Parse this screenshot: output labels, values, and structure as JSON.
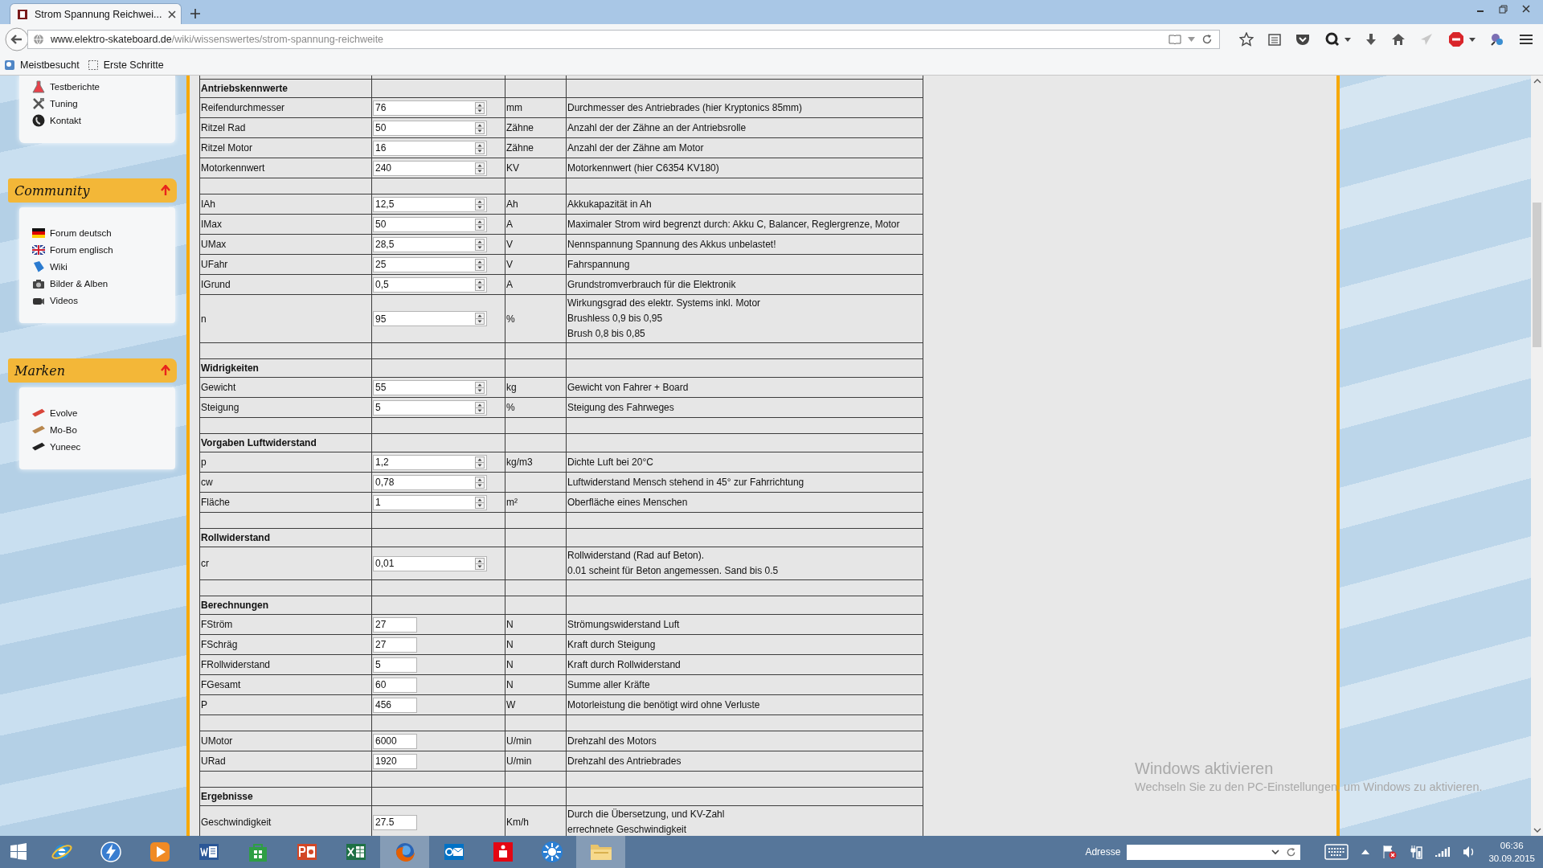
{
  "browser": {
    "tabs": [
      {
        "title": "Strom Spannung Reichwei...",
        "selected": true
      }
    ],
    "address": {
      "domain": "www.elektro-skateboard.de",
      "path": "/wiki/wissenswertes/strom-spannung-reichweite"
    },
    "bookmarks": [
      {
        "label": "Meistbesucht",
        "kind": "folder"
      },
      {
        "label": "Erste Schritte",
        "kind": "page"
      }
    ]
  },
  "sidebar": {
    "top_items": [
      {
        "label": "Testberichte",
        "kind": "flask"
      },
      {
        "label": "Tuning",
        "kind": "tools"
      },
      {
        "label": "Kontakt",
        "kind": "phone"
      }
    ],
    "sections": [
      {
        "title": "Community",
        "items": [
          {
            "label": "Forum deutsch",
            "kind": "germany"
          },
          {
            "label": "Forum englisch",
            "kind": "britain"
          },
          {
            "label": "Wiki",
            "kind": "book"
          },
          {
            "label": "Bilder & Alben",
            "kind": "camera"
          },
          {
            "label": "Videos",
            "kind": "camcorder"
          }
        ]
      },
      {
        "title": "Marken",
        "items": [
          {
            "label": "Evolve",
            "kind": "board",
            "color": "#d8453a"
          },
          {
            "label": "Mo-Bo",
            "kind": "board",
            "color": "#b8874e"
          },
          {
            "label": "Yuneec",
            "kind": "board",
            "color": "#222222"
          }
        ]
      }
    ]
  },
  "table": {
    "rows": [
      {
        "kind": "section",
        "label": "Antriebskennwerte"
      },
      {
        "kind": "spin",
        "parameter": "Reifendurchmesser",
        "value": "76",
        "unit": "mm",
        "remark": [
          "Durchmesser des Antriebrades (hier Kryptonics 85mm)"
        ]
      },
      {
        "kind": "spin",
        "parameter": "Ritzel Rad",
        "value": "50",
        "unit": "Zähne",
        "remark": [
          "Anzahl der der Zähne an der Antriebsrolle"
        ]
      },
      {
        "kind": "spin",
        "parameter": "Ritzel Motor",
        "value": "16",
        "unit": "Zähne",
        "remark": [
          "Anzahl der der Zähne am Motor"
        ]
      },
      {
        "kind": "spin",
        "parameter": "Motorkennwert",
        "value": "240",
        "unit": "KV",
        "remark": [
          "Motorkennwert (hier C6354 KV180)"
        ]
      },
      {
        "kind": "blank"
      },
      {
        "kind": "spin",
        "parameter": "IAh",
        "value": "12,5",
        "unit": "Ah",
        "remark": [
          "Akkukapazität in Ah"
        ]
      },
      {
        "kind": "spin",
        "parameter": "IMax",
        "value": "50",
        "unit": "A",
        "remark": [
          "Maximaler Strom wird begrenzt durch: Akku C, Balancer, Reglergrenze, Motor"
        ]
      },
      {
        "kind": "spin",
        "parameter": "UMax",
        "value": "28,5",
        "unit": "V",
        "remark": [
          "Nennspannung Spannung des Akkus unbelastet!"
        ]
      },
      {
        "kind": "spin",
        "parameter": "UFahr",
        "value": "25",
        "unit": "V",
        "remark": [
          "Fahrspannung"
        ]
      },
      {
        "kind": "spin",
        "parameter": "IGrund",
        "value": "0,5",
        "unit": "A",
        "remark": [
          "Grundstromverbrauch für die Elektronik"
        ]
      },
      {
        "kind": "spin",
        "parameter": "n",
        "value": "95",
        "unit": "%",
        "remark": [
          "Wirkungsgrad des elektr. Systems inkl. Motor",
          "Brushless 0,9 bis 0,95",
          "Brush 0,8 bis 0,85"
        ]
      },
      {
        "kind": "blank"
      },
      {
        "kind": "section",
        "label": "Widrigkeiten"
      },
      {
        "kind": "spin",
        "parameter": "Gewicht",
        "value": "55",
        "unit": "kg",
        "remark": [
          "Gewicht von Fahrer + Board"
        ]
      },
      {
        "kind": "spin",
        "parameter": "Steigung",
        "value": "5",
        "unit": "%",
        "remark": [
          "Steigung des Fahrweges"
        ]
      },
      {
        "kind": "blank"
      },
      {
        "kind": "section",
        "label": "Vorgaben Luftwiderstand"
      },
      {
        "kind": "spin",
        "parameter": "p",
        "value": "1,2",
        "unit": "kg/m3",
        "remark": [
          "Dichte Luft bei 20°C"
        ]
      },
      {
        "kind": "spin",
        "parameter": "cw",
        "value": "0,78",
        "remark": [
          "Luftwiderstand Mensch stehend in 45° zur Fahrrichtung"
        ]
      },
      {
        "kind": "spin",
        "parameter": "Fläche",
        "value": "1",
        "unit": "m²",
        "remark": [
          "Oberfläche eines Menschen"
        ]
      },
      {
        "kind": "blank"
      },
      {
        "kind": "section",
        "label": "Rollwiderstand"
      },
      {
        "kind": "spin",
        "parameter": "cr",
        "value": "0,01",
        "remark": [
          "Rollwiderstand (Rad auf Beton).",
          "0.01 scheint für Beton angemessen. Sand bis 0.5"
        ]
      },
      {
        "kind": "blank"
      },
      {
        "kind": "section",
        "label": "Berechnungen"
      },
      {
        "kind": "output",
        "parameter": "FStröm",
        "value": "27",
        "unit": "N",
        "remark": [
          "Strömungswiderstand Luft"
        ]
      },
      {
        "kind": "output",
        "parameter": "FSchräg",
        "value": "27",
        "unit": "N",
        "remark": [
          "Kraft durch Steigung"
        ]
      },
      {
        "kind": "output",
        "parameter": "FRollwiderstand",
        "value": "5",
        "unit": "N",
        "remark": [
          "Kraft durch Rollwiderstand"
        ]
      },
      {
        "kind": "output",
        "parameter": "FGesamt",
        "value": "60",
        "unit": "N",
        "remark": [
          "Summe aller Kräfte"
        ]
      },
      {
        "kind": "output",
        "parameter": "P",
        "value": "456",
        "unit": "W",
        "remark": [
          "Motorleistung die benötigt wird ohne Verluste"
        ]
      },
      {
        "kind": "blank"
      },
      {
        "kind": "output",
        "parameter": "UMotor",
        "value": "6000",
        "unit": "U/min",
        "remark": [
          "Drehzahl des Motors"
        ]
      },
      {
        "kind": "output",
        "parameter": "URad",
        "value": "1920",
        "unit": "U/min",
        "remark": [
          "Drehzahl des Antriebrades"
        ]
      },
      {
        "kind": "blank"
      },
      {
        "kind": "section",
        "label": "Ergebnisse"
      },
      {
        "kind": "output",
        "parameter": "Geschwindigkeit",
        "value": "27.5",
        "unit": "Km/h",
        "remark": [
          "Durch die Übersetzung, und KV-Zahl",
          "errechnete Geschwindigkeit"
        ]
      }
    ]
  },
  "notice": {
    "title": "Windows aktivieren",
    "text": "Wechseln Sie zu den PC-Einstellungen, um Windows zu aktivieren."
  },
  "taskbar": {
    "apps": [
      {
        "kind": "start",
        "running": false
      },
      {
        "kind": "orbit",
        "running": false
      },
      {
        "kind": "bolt",
        "running": false
      },
      {
        "kind": "play",
        "running": false
      },
      {
        "kind": "document",
        "running": false
      },
      {
        "kind": "bag",
        "running": false
      },
      {
        "kind": "slides",
        "running": false
      },
      {
        "kind": "sheet",
        "running": false
      },
      {
        "kind": "fox",
        "running": true
      },
      {
        "kind": "mail",
        "running": false
      },
      {
        "kind": "card",
        "running": false
      },
      {
        "kind": "sun",
        "running": false
      },
      {
        "kind": "folder",
        "running": true
      }
    ],
    "address_label": "Adresse",
    "time": "06:36",
    "date": "30.09.2015"
  }
}
